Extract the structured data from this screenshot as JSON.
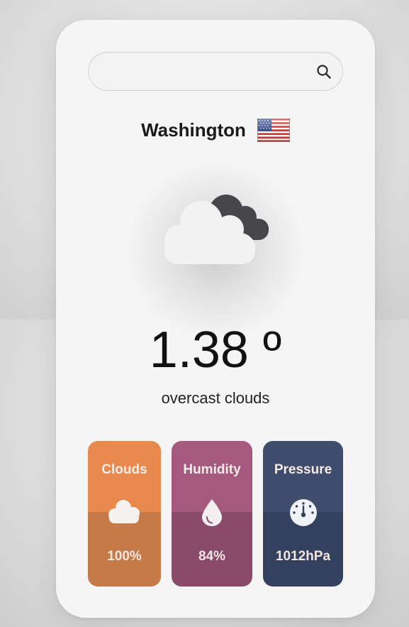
{
  "search": {
    "value": "",
    "placeholder": "",
    "icon": "search-icon"
  },
  "location": {
    "city": "Washington",
    "flag_icon": "us-flag-icon"
  },
  "weather": {
    "icon": "overcast-clouds-icon",
    "temperature": "1.38 º",
    "description": "overcast clouds"
  },
  "stats": [
    {
      "label": "Clouds",
      "value": "100%",
      "icon": "cloud-icon",
      "color_top": "#e88a4d",
      "color_bottom": "#c67a48"
    },
    {
      "label": "Humidity",
      "value": "84%",
      "icon": "water-drop-icon",
      "color_top": "#a6597f",
      "color_bottom": "#8a4a6a"
    },
    {
      "label": "Pressure",
      "value": "1012hPa",
      "icon": "gauge-icon",
      "color_top": "#3f4c6e",
      "color_bottom": "#33405e"
    }
  ]
}
